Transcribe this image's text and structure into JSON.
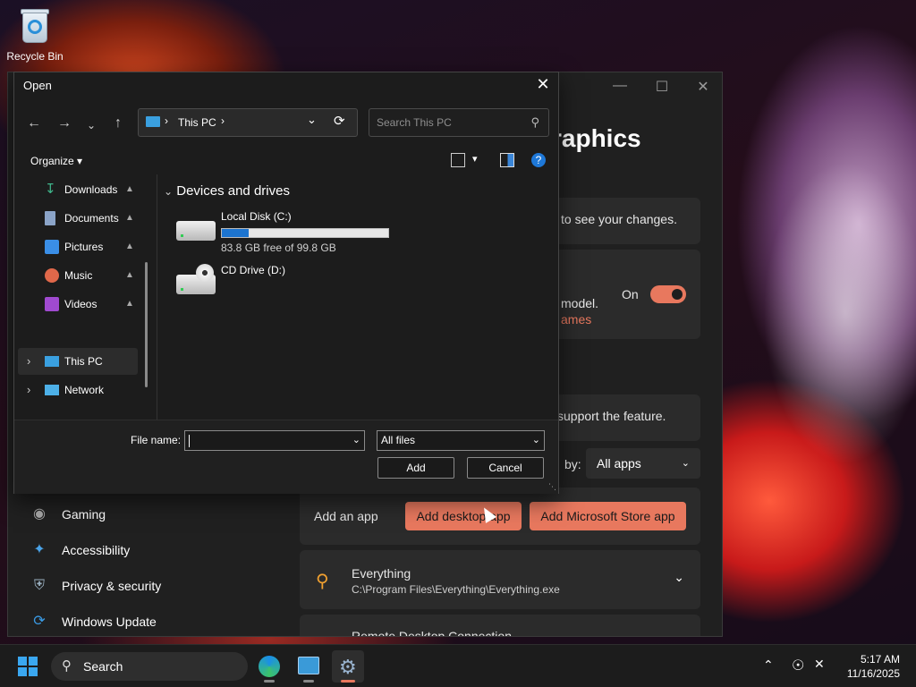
{
  "desktop": {
    "recycle_bin_label": "Recycle Bin"
  },
  "settings": {
    "title_partial": "raphics",
    "card1_text": "to see your changes.",
    "card2_text1": "model.",
    "card2_link": "ames",
    "toggle_label": "On",
    "card3_text": "support the feature.",
    "filter_prefix": "by:",
    "filter_value": "All apps",
    "add_app_label": "Add an app",
    "add_desktop_app": "Add desktop app",
    "add_store_app": "Add Microsoft Store app",
    "app_item": {
      "name": "Everything",
      "path": "C:\\Program Files\\Everything\\Everything.exe"
    },
    "app_item2_partial": "Remote Desktop Connection",
    "nav": [
      {
        "label": "Gaming",
        "icon": "gamepad-icon"
      },
      {
        "label": "Accessibility",
        "icon": "accessibility-icon"
      },
      {
        "label": "Privacy & security",
        "icon": "shield-icon"
      },
      {
        "label": "Windows Update",
        "icon": "update-icon"
      }
    ],
    "accent": "#e8785e"
  },
  "dialog": {
    "title": "Open",
    "address": {
      "location": "This PC"
    },
    "search_placeholder": "Search This PC",
    "organize_label": "Organize",
    "quick_access": [
      {
        "label": "Downloads",
        "icon": "download-icon",
        "color": "#3fb68b"
      },
      {
        "label": "Documents",
        "icon": "documents-icon",
        "color": "#8ba4c8"
      },
      {
        "label": "Pictures",
        "icon": "pictures-icon",
        "color": "#3a8ee6"
      },
      {
        "label": "Music",
        "icon": "music-icon",
        "color": "#e0684a"
      },
      {
        "label": "Videos",
        "icon": "videos-icon",
        "color": "#a04ad0"
      }
    ],
    "tree": [
      {
        "label": "This PC",
        "icon": "computer-icon"
      },
      {
        "label": "Network",
        "icon": "network-icon"
      }
    ],
    "group_header": "Devices and drives",
    "drives": [
      {
        "name": "Local Disk (C:)",
        "free_text": "83.8 GB free of 99.8 GB",
        "used_fraction": 0.16
      },
      {
        "name": "CD Drive (D:)"
      }
    ],
    "file_name_label": "File name:",
    "file_name_value": "",
    "file_type_value": "All files",
    "primary_button": "Add",
    "cancel_button": "Cancel"
  },
  "taskbar": {
    "search_label": "Search",
    "time": "5:17 AM",
    "date": "11/16/2025"
  }
}
